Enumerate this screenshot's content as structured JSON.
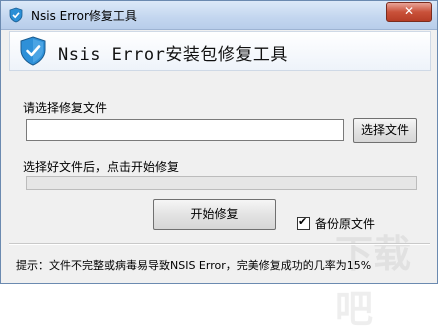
{
  "window": {
    "title": "Nsis Error修复工具",
    "close_label": "✕"
  },
  "header": {
    "app_title": "Nsis Error安装包修复工具"
  },
  "form": {
    "select_label": "请选择修复文件",
    "file_value": "",
    "browse_label": "选择文件",
    "hint": "选择好文件后，点击开始修复",
    "progress": 0,
    "start_label": "开始修复",
    "backup_label": "备份原文件",
    "backup_checked": true
  },
  "status": {
    "text": "提示：文件不完整或病毒易导致NSIS Error，完美修复成功的几率为15%"
  },
  "colors": {
    "accent": "#2b8fd6",
    "close": "#c9513a"
  }
}
